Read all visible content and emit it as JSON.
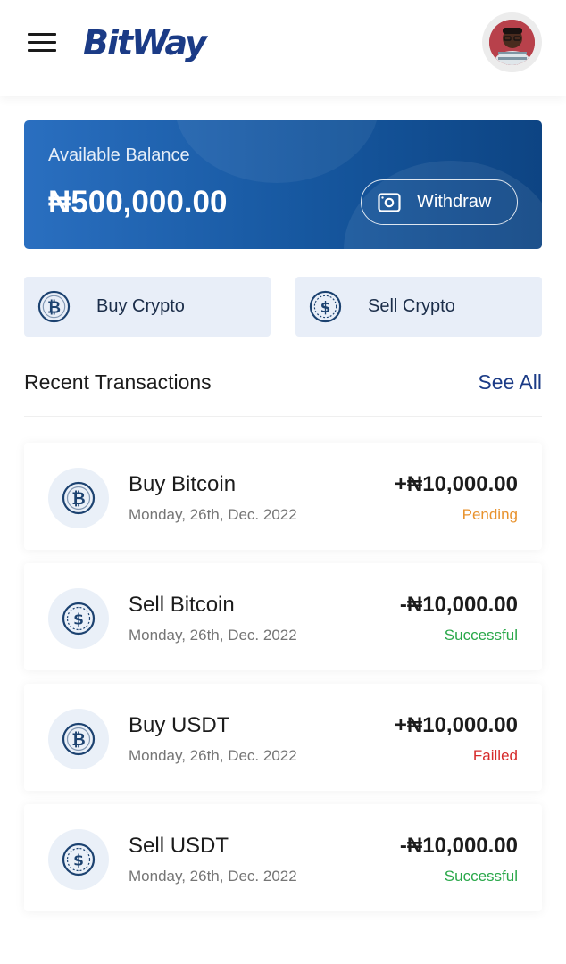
{
  "header": {
    "logo_text": "BitWay",
    "menu_icon": "hamburger-menu-icon",
    "avatar_icon": "user-avatar"
  },
  "balance": {
    "label": "Available Balance",
    "amount": "₦500,000.00",
    "withdraw_label": "Withdraw",
    "withdraw_icon": "wallet-icon"
  },
  "actions": {
    "buy_label": "Buy Crypto",
    "buy_icon": "bitcoin-icon",
    "sell_label": "Sell Crypto",
    "sell_icon": "dollar-coin-icon"
  },
  "transactions": {
    "title": "Recent Transactions",
    "see_all": "See All",
    "items": [
      {
        "name": "Buy Bitcoin",
        "date": "Monday, 26th, Dec. 2022",
        "amount": "+₦10,000.00",
        "status": "Pending",
        "icon": "bitcoin-icon"
      },
      {
        "name": "Sell Bitcoin",
        "date": "Monday, 26th, Dec. 2022",
        "amount": "-₦10,000.00",
        "status": "Successful",
        "icon": "dollar-coin-icon"
      },
      {
        "name": "Buy USDT",
        "date": "Monday, 26th, Dec. 2022",
        "amount": "+₦10,000.00",
        "status": "Failled",
        "icon": "bitcoin-icon"
      },
      {
        "name": "Sell USDT",
        "date": "Monday, 26th, Dec. 2022",
        "amount": "-₦10,000.00",
        "status": "Successful",
        "icon": "dollar-coin-icon"
      }
    ]
  },
  "colors": {
    "brand": "#1b3b86",
    "card_start": "#2a6fc0",
    "card_end": "#0d4483",
    "pending": "#e8922d",
    "successful": "#2aa84a",
    "failed": "#d62b2b"
  }
}
